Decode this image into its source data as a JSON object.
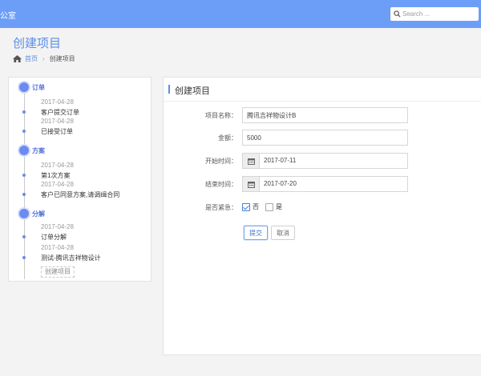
{
  "header": {
    "app_name": "公室",
    "search": {
      "placeholder": "Search ...",
      "value": ""
    }
  },
  "page": {
    "title": "创建项目",
    "breadcrumb": {
      "home": "首页",
      "separator": "›",
      "current": "创建项目"
    }
  },
  "timeline": {
    "stages": [
      {
        "label": "订单",
        "events": [
          {
            "date": "2017-04-28",
            "desc": "客户提交订单"
          },
          {
            "date": "2017-04-28",
            "desc": "已接受订单"
          }
        ]
      },
      {
        "label": "方案",
        "events": [
          {
            "date": "2017-04-28",
            "desc": "第1次方案"
          },
          {
            "date": "2017-04-28",
            "desc": "客户已同意方案,请调缉合同"
          }
        ]
      },
      {
        "label": "分解",
        "events": [
          {
            "date": "2017-04-28",
            "desc": "订单分解"
          },
          {
            "date": "2017-04-28",
            "desc": "测试-腾讯吉祥物设计"
          }
        ]
      }
    ],
    "footer": "创建项目"
  },
  "form": {
    "panel_title": "创建项目",
    "fields": {
      "project_name": {
        "label": "项目名称：",
        "value": "腾讯吉祥物设计B"
      },
      "amount": {
        "label": "金额：",
        "value": "5000"
      },
      "start_date": {
        "label": "开始时间：",
        "value": "2017-07-11"
      },
      "end_date": {
        "label": "结束时间：",
        "value": "2017-07-20"
      },
      "urgent": {
        "label": "是否紧急：",
        "options": [
          "否",
          "是"
        ],
        "selected": "否"
      }
    },
    "submit_label": "提交",
    "cancel_label": "取消"
  },
  "colors": {
    "topbar": "#6c9ef8",
    "accent": "#5b8ee6",
    "timeline_dot": "#6c8bf0"
  }
}
